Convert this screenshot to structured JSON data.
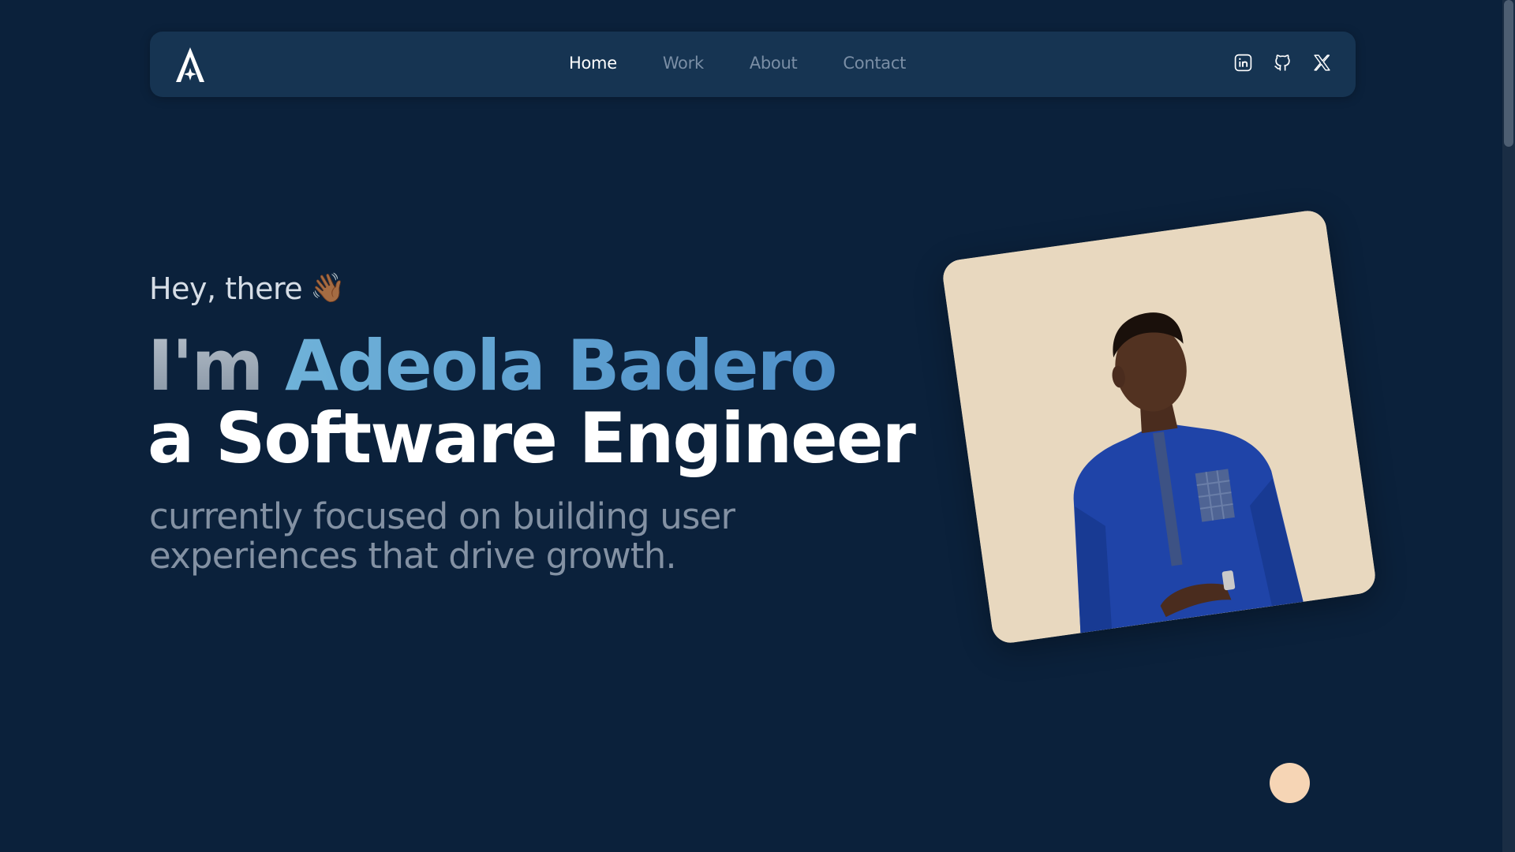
{
  "nav": {
    "logo_icon": "a-star-logo-icon",
    "links": [
      {
        "label": "Home",
        "active": true
      },
      {
        "label": "Work",
        "active": false
      },
      {
        "label": "About",
        "active": false
      },
      {
        "label": "Contact",
        "active": false
      }
    ],
    "socials": [
      "linkedin-icon",
      "github-icon",
      "x-icon"
    ]
  },
  "hero": {
    "greeting": "Hey, there",
    "wave_emoji": "👋🏾",
    "im": "I'm ",
    "name": "Adeola Badero",
    "role": "a Software Engineer",
    "subtext": "currently focused on building user experiences that drive growth."
  },
  "colors": {
    "background": "#0b213b",
    "navbar": "#163452",
    "accent": "#5aa0d0",
    "dot": "#f6d5b5",
    "portrait_bg": "#e8d8bf"
  }
}
